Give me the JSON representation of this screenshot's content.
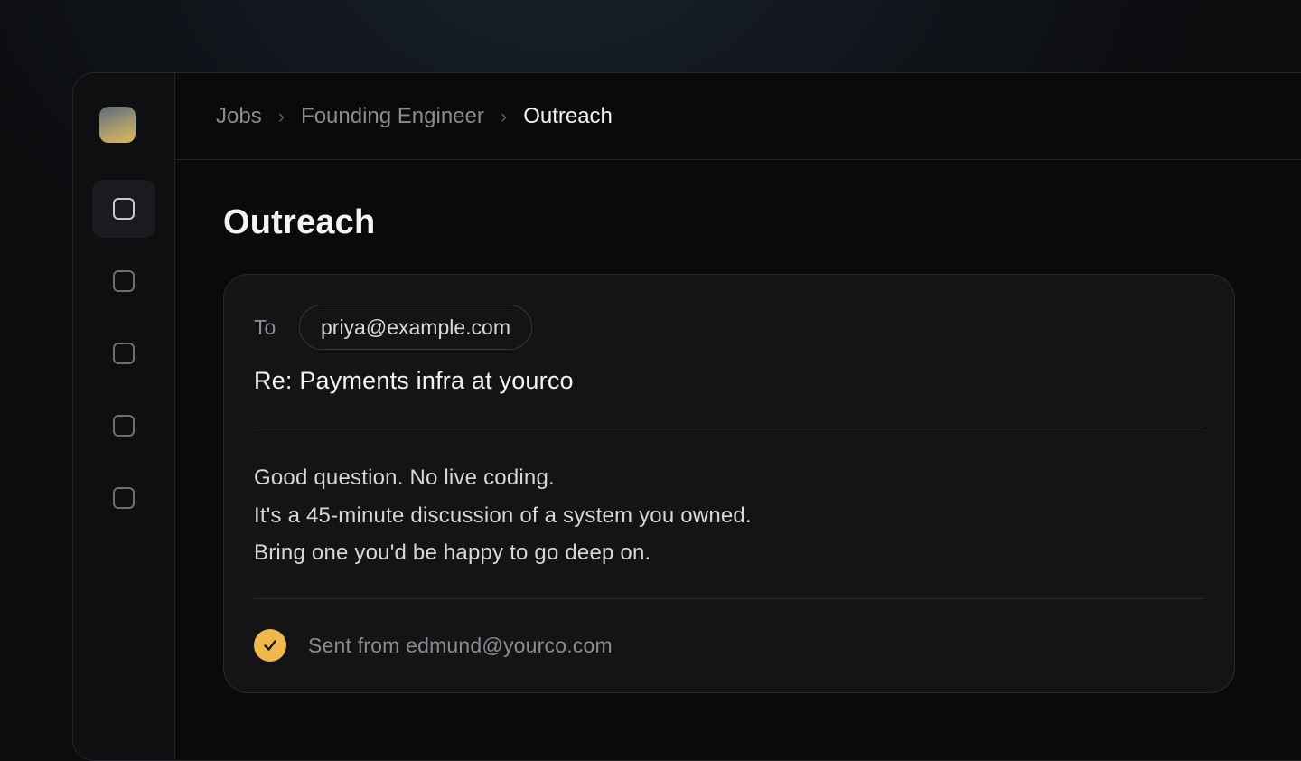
{
  "breadcrumb": {
    "items": [
      "Jobs",
      "Founding Engineer"
    ],
    "current": "Outreach",
    "separator": "›"
  },
  "page": {
    "title": "Outreach"
  },
  "sidebar": {
    "items": [
      {
        "icon": "square-icon",
        "active": true
      },
      {
        "icon": "square-icon",
        "active": false
      },
      {
        "icon": "square-icon",
        "active": false
      },
      {
        "icon": "square-icon",
        "active": false
      },
      {
        "icon": "square-icon",
        "active": false
      }
    ]
  },
  "email": {
    "to_label": "To",
    "recipient": "priya@example.com",
    "subject": "Re: Payments infra at yourco",
    "body_lines": [
      "Good question. No live coding.",
      "It's a 45-minute discussion of a system you owned.",
      "Bring one you'd be happy to go deep on."
    ],
    "status": "Sent from edmund@yourco.com",
    "status_icon": "check-circle-icon"
  },
  "colors": {
    "accent": "#f0b94e",
    "background": "#0a0a0b",
    "card": "#141416"
  }
}
